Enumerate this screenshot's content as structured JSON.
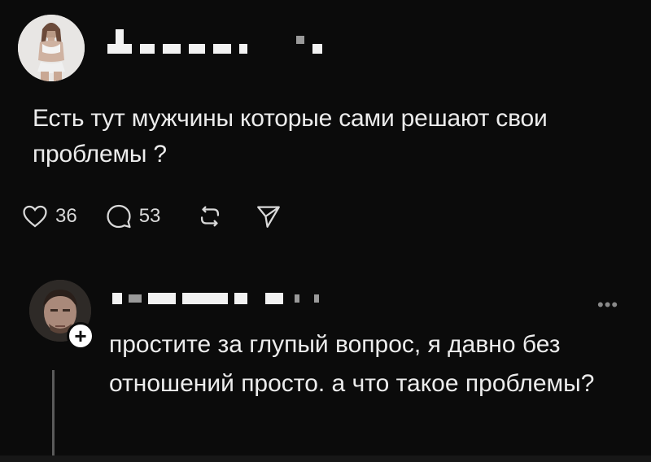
{
  "post": {
    "text": "Есть тут мужчины которые сами решают свои проблемы ?",
    "likes": "36",
    "comments": "53"
  },
  "reply": {
    "text": "простите за глупый вопрос, я давно без отношений просто. а что такое проблемы?",
    "more_label": "•••",
    "plus_label": "+"
  },
  "icons": {
    "like": "heart-icon",
    "comment": "comment-bubble-icon",
    "repost": "repost-icon",
    "share": "send-icon",
    "more": "more-dots-icon",
    "follow": "plus-icon"
  },
  "colors": {
    "background": "#0b0b0b",
    "text": "#ececec",
    "icon": "#d9d9d9"
  }
}
